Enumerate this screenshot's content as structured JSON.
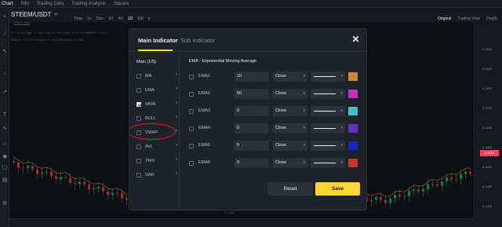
{
  "topnav": {
    "items": [
      "Chart",
      "Info",
      "Trading Data",
      "Trading Analysis",
      "Square"
    ]
  },
  "symbol": {
    "pair": "STEEM/USDT",
    "sub": "Depth chart"
  },
  "timeframes": [
    "Time",
    "1s",
    "15m",
    "1H",
    "4H",
    "1D",
    "1W"
  ],
  "active_timeframe": "1D",
  "right_controls": [
    "Original",
    "Trading View",
    "Depth"
  ],
  "ohlc": "O: 0.1715  High: 0.1787  Low: 0.1704  Close: 0.1719  CHANGE: 0.17%",
  "indicators_line": "EMA(7): 0.1729  EMA(25): 0.1823  WMA(99): 0.1758",
  "price_scale": [
    "0.2800",
    "0.2600",
    "0.2400",
    "0.2200",
    "0.2000",
    "0.1800",
    "0.1600",
    "0.1400",
    "0.1200"
  ],
  "last_price": "0.1719",
  "low_label": "0.1264",
  "modal": {
    "tab_main": "Main Indicator",
    "tab_sub": "Sub Indicator",
    "list_title": "Main (1/5)",
    "list": [
      {
        "label": "MA",
        "checked": false
      },
      {
        "label": "EMA",
        "checked": false
      },
      {
        "label": "WMA",
        "checked": true
      },
      {
        "label": "BOLL",
        "checked": false
      },
      {
        "label": "VWAP",
        "checked": false
      },
      {
        "label": "AVL",
        "checked": false
      },
      {
        "label": "TRIX",
        "checked": false
      },
      {
        "label": "SAR",
        "checked": false
      }
    ],
    "panel_title": "EMA - Exponential Moving Average",
    "rows": [
      {
        "label": "EMA1",
        "value": "10",
        "source": "Close",
        "color": "#c98a34"
      },
      {
        "label": "EMA2",
        "value": "50",
        "source": "Close",
        "color": "#c52fc4"
      },
      {
        "label": "EMA3",
        "value": "0",
        "source": "Close",
        "color": "#3fc1c9"
      },
      {
        "label": "EMA4",
        "value": "0",
        "source": "Close",
        "color": "#6a2fc4"
      },
      {
        "label": "EMA5",
        "value": "0",
        "source": "Close",
        "color": "#1a24c9"
      },
      {
        "label": "EMA6",
        "value": "0",
        "source": "Close",
        "color": "#c9342f"
      }
    ],
    "reset_label": "Reset",
    "save_label": "Save"
  }
}
